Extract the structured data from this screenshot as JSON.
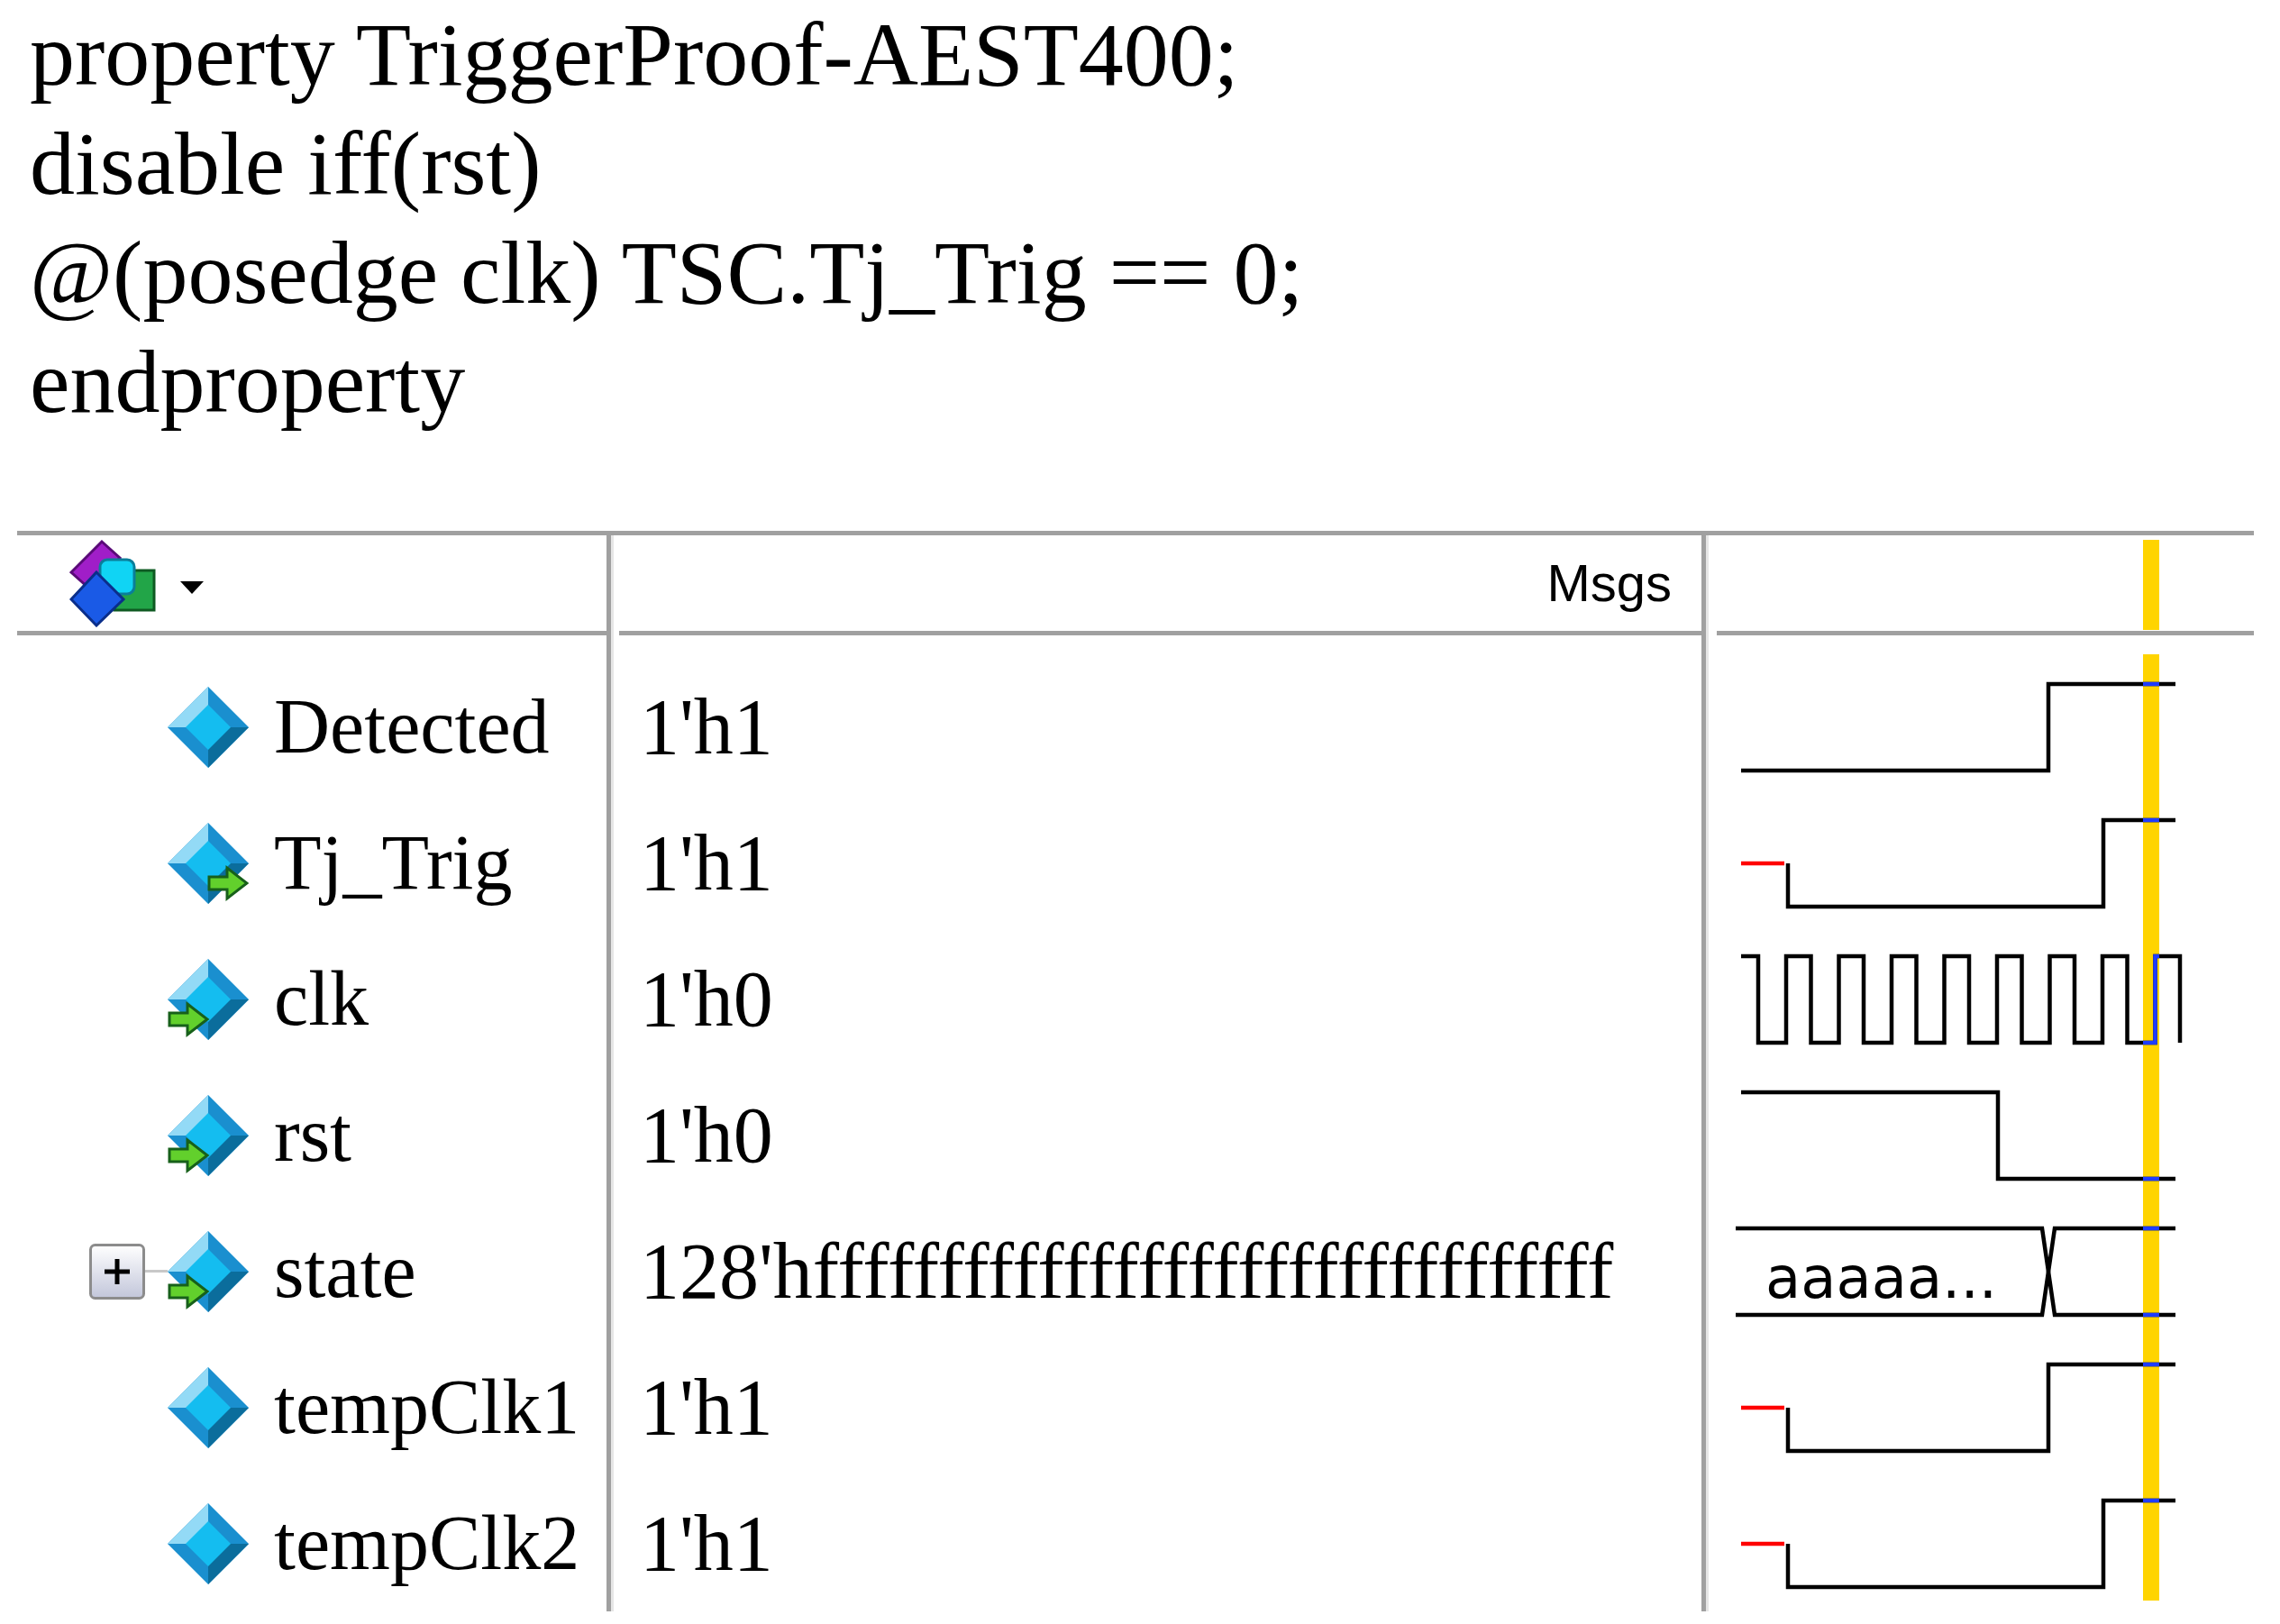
{
  "code_lines": [
    "property TriggerProof-AEST400;",
    "disable iff(rst)",
    "@(posedge clk) TSC.Tj_Trig == 0;",
    "endproperty"
  ],
  "wave_window": {
    "values_header": "Msgs",
    "signals": [
      {
        "name": "Detected",
        "value": "1'h1",
        "kind": "internal"
      },
      {
        "name": "Tj_Trig",
        "value": "1'h1",
        "kind": "output"
      },
      {
        "name": "clk",
        "value": "1'h0",
        "kind": "input"
      },
      {
        "name": "rst",
        "value": "1'h0",
        "kind": "input"
      },
      {
        "name": "state",
        "value": "128'hffffffffffffffffffffffffffffffff",
        "kind": "input",
        "expanded": false,
        "wave_label": "aaaaa..."
      },
      {
        "name": "tempClk1",
        "value": "1'h1",
        "kind": "internal"
      },
      {
        "name": "tempClk2",
        "value": "1'h1",
        "kind": "internal"
      }
    ]
  }
}
